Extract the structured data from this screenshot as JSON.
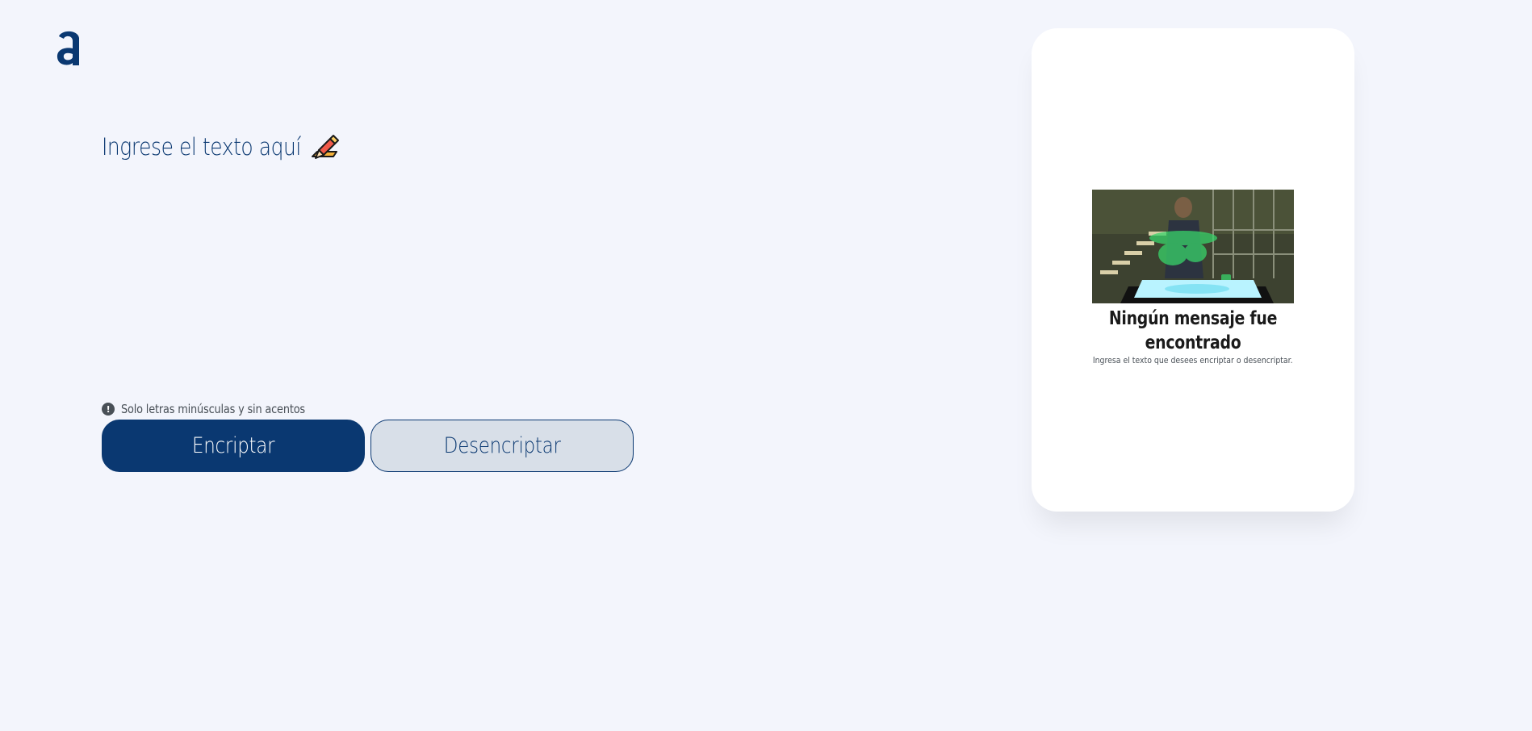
{
  "logo": {
    "icon": "alura-a-logo-icon",
    "color": "#0a3871"
  },
  "input": {
    "placeholder": "Ingrese el texto aquí",
    "icon": "pencil-writing-icon"
  },
  "hint": {
    "icon": "info-icon",
    "text": "Solo letras minúsculas y sin acentos"
  },
  "buttons": {
    "encrypt_label": "Encriptar",
    "decrypt_label": "Desencriptar"
  },
  "result": {
    "image": "hologram-person-image",
    "title": "Ningún mensaje fue encontrado",
    "subtitle": "Ingresa el texto que desees encriptar o desencriptar."
  },
  "colors": {
    "background": "#f3f5fc",
    "primary": "#0a3871",
    "secondary_button": "#d8dfe8",
    "card": "#ffffff"
  }
}
